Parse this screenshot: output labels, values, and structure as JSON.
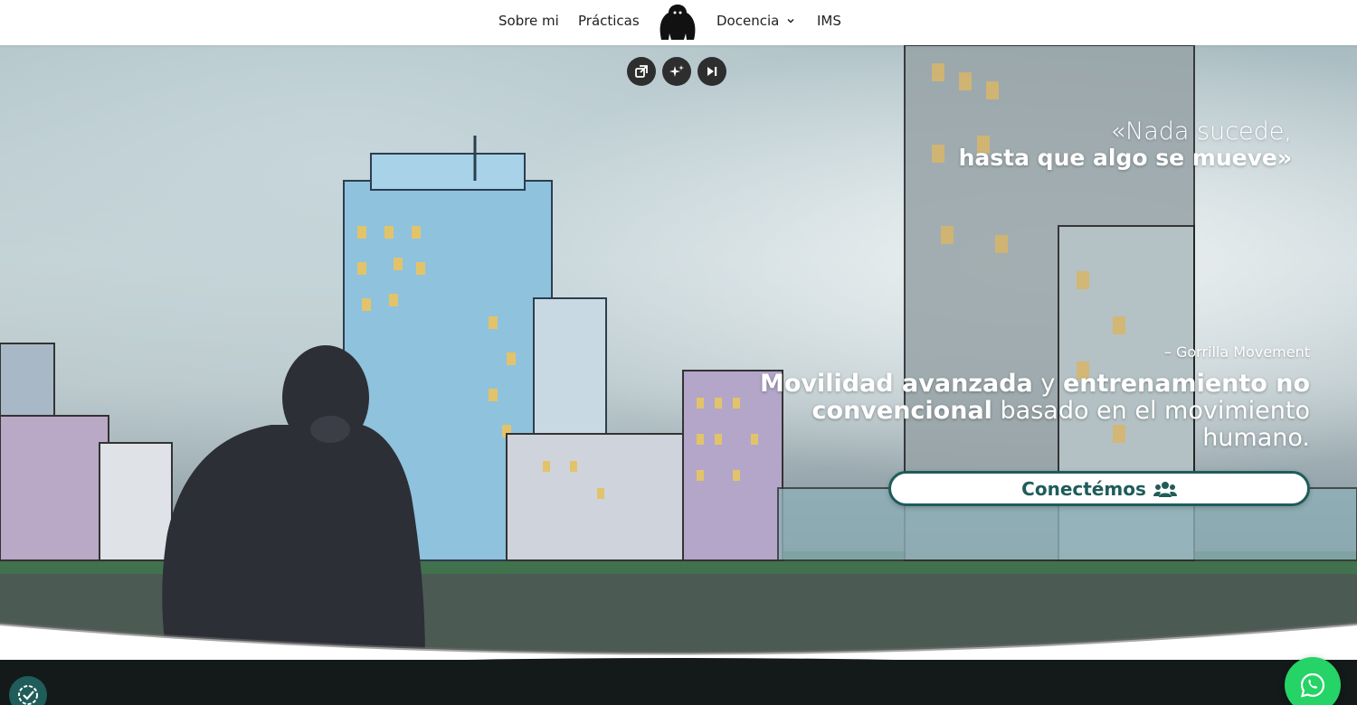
{
  "nav": {
    "items": [
      {
        "label": "Sobre mi"
      },
      {
        "label": "Prácticas"
      },
      {
        "label": "Docencia"
      },
      {
        "label": "IMS"
      }
    ],
    "logo_icon": "gorilla-logo-icon"
  },
  "media_controls": {
    "icons": [
      "popout-icon",
      "sparkle-icon",
      "skip-forward-icon"
    ]
  },
  "hero": {
    "quote_line1": "«Nada sucede,",
    "quote_line2": "hasta que algo se mueve»",
    "attribution": "– Gorrilla Movement",
    "tagline": {
      "part1": "Movilidad avanzada",
      "part2": " y ",
      "part3": "entrenamiento no convencional",
      "part4": " basado en el movimiento humano."
    },
    "cta_label": "Conectémos",
    "cta_icon": "users-icon"
  },
  "floating": {
    "whatsapp_icon": "whatsapp-icon",
    "consent_icon": "cookie-consent-icon"
  },
  "colors": {
    "brand": "#1f5c5a",
    "whatsapp": "#25d366",
    "nav_text": "#222222"
  }
}
